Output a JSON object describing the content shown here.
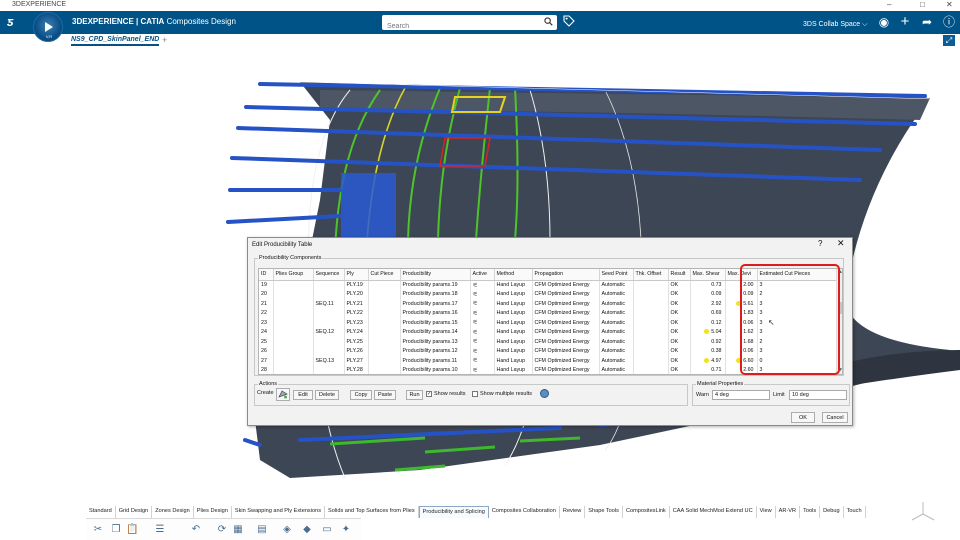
{
  "os_window": {
    "title": "3DEXPERIENCE",
    "controls": [
      "–",
      "□",
      "✕"
    ]
  },
  "header": {
    "brand_bold": "3DEXPERIENCE | CATIA",
    "brand_app": "Composites Design",
    "compass_label": "V,R",
    "search_placeholder": "Search",
    "collab_space": "3DS Collab Space ⌵",
    "colors": {
      "header_bg": "#005386",
      "accent": "#0a4f82"
    }
  },
  "document_tab": {
    "name": "NS9_CPD_SkinPanel_END",
    "add": "+"
  },
  "dialog": {
    "title": "Edit Producibility Table",
    "help": "?",
    "close": "✕",
    "components_group": "Producibility Components",
    "columns": [
      "ID",
      "Plies Group",
      "Sequence",
      "Ply",
      "Cut Piece",
      "Producibility",
      "Active",
      "Method",
      "Propagation",
      "Seed Point",
      "Thk. Offset",
      "Result",
      "Max. Shear",
      "Max. Devi",
      "Estimated Cut Pieces"
    ],
    "rows": [
      {
        "id": "19",
        "group": "",
        "seq": "",
        "ply": "PLY.19",
        "cut": "",
        "prod": "Producibility params.19",
        "method": "Hand Layup",
        "prop": "CFM Optimized Energy",
        "seed": "Automatic",
        "thk": "",
        "result": "OK",
        "shear": "0.73",
        "shear_warn": false,
        "dev": "2.00",
        "dev_warn": false,
        "cuts": "3"
      },
      {
        "id": "20",
        "group": "",
        "seq": "",
        "ply": "PLY.20",
        "cut": "",
        "prod": "Producibility params.18",
        "method": "Hand Layup",
        "prop": "CFM Optimized Energy",
        "seed": "Automatic",
        "thk": "",
        "result": "OK",
        "shear": "0.09",
        "shear_warn": false,
        "dev": "0.09",
        "dev_warn": false,
        "cuts": "2"
      },
      {
        "id": "21",
        "group": "",
        "seq": "SEQ.11",
        "ply": "PLY.21",
        "cut": "",
        "prod": "Producibility params.17",
        "method": "Hand Layup",
        "prop": "CFM Optimized Energy",
        "seed": "Automatic",
        "thk": "",
        "result": "OK",
        "shear": "2.92",
        "shear_warn": false,
        "dev": "5.61",
        "dev_warn": true,
        "cuts": "3"
      },
      {
        "id": "22",
        "group": "",
        "seq": "",
        "ply": "PLY.22",
        "cut": "",
        "prod": "Producibility params.16",
        "method": "Hand Layup",
        "prop": "CFM Optimized Energy",
        "seed": "Automatic",
        "thk": "",
        "result": "OK",
        "shear": "0.69",
        "shear_warn": false,
        "dev": "1.83",
        "dev_warn": false,
        "cuts": "3"
      },
      {
        "id": "23",
        "group": "",
        "seq": "",
        "ply": "PLY.23",
        "cut": "",
        "prod": "Producibility params.15",
        "method": "Hand Layup",
        "prop": "CFM Optimized Energy",
        "seed": "Automatic",
        "thk": "",
        "result": "OK",
        "shear": "0.12",
        "shear_warn": false,
        "dev": "0.06",
        "dev_warn": false,
        "cuts": "3"
      },
      {
        "id": "24",
        "group": "",
        "seq": "SEQ.12",
        "ply": "PLY.24",
        "cut": "",
        "prod": "Producibility params.14",
        "method": "Hand Layup",
        "prop": "CFM Optimized Energy",
        "seed": "Automatic",
        "thk": "",
        "result": "OK",
        "shear": "5.04",
        "shear_warn": true,
        "dev": "1.62",
        "dev_warn": false,
        "cuts": "3"
      },
      {
        "id": "25",
        "group": "",
        "seq": "",
        "ply": "PLY.25",
        "cut": "",
        "prod": "Producibility params.13",
        "method": "Hand Layup",
        "prop": "CFM Optimized Energy",
        "seed": "Automatic",
        "thk": "",
        "result": "OK",
        "shear": "0.92",
        "shear_warn": false,
        "dev": "1.68",
        "dev_warn": false,
        "cuts": "2"
      },
      {
        "id": "26",
        "group": "",
        "seq": "",
        "ply": "PLY.26",
        "cut": "",
        "prod": "Producibility params.12",
        "method": "Hand Layup",
        "prop": "CFM Optimized Energy",
        "seed": "Automatic",
        "thk": "",
        "result": "OK",
        "shear": "0.38",
        "shear_warn": false,
        "dev": "0.06",
        "dev_warn": false,
        "cuts": "3"
      },
      {
        "id": "27",
        "group": "",
        "seq": "SEQ.13",
        "ply": "PLY.27",
        "cut": "",
        "prod": "Producibility params.11",
        "method": "Hand Layup",
        "prop": "CFM Optimized Energy",
        "seed": "Automatic",
        "thk": "",
        "result": "OK",
        "shear": "4.97",
        "shear_warn": true,
        "dev": "6.60",
        "dev_warn": true,
        "cuts": "0"
      },
      {
        "id": "28",
        "group": "",
        "seq": "",
        "ply": "PLY.28",
        "cut": "",
        "prod": "Producibility params.10",
        "method": "Hand Layup",
        "prop": "CFM Optimized Energy",
        "seed": "Automatic",
        "thk": "",
        "result": "OK",
        "shear": "0.71",
        "shear_warn": false,
        "dev": "2.60",
        "dev_warn": false,
        "cuts": "3"
      }
    ],
    "actions": {
      "group": "Actions",
      "create": "Create",
      "edit": "Edit",
      "delete": "Delete",
      "copy": "Copy",
      "paste": "Paste",
      "run": "Run",
      "show_results": "Show results",
      "show_results_checked": true,
      "show_multiple": "Show multiple results",
      "show_multiple_checked": false
    },
    "material": {
      "group": "Material Properties",
      "warn_label": "Warn",
      "warn_value": "4 deg",
      "limit_label": "Limit",
      "limit_value": "10 deg"
    },
    "ok": "OK",
    "cancel": "Cancel"
  },
  "workbench_tabs": [
    "Standard",
    "Grid Design",
    "Zones Design",
    "Plies Design",
    "Skin Swapping and Ply Extensions",
    "Solids and Top Surfaces from Plies",
    "Producibility and Splicing",
    "Composites Collaboration",
    "Review",
    "Shape Tools",
    "CompositesLink",
    "CAA Solid MechMod Extend UC",
    "View",
    "AR-VR",
    "Tools",
    "Debug",
    "Touch"
  ],
  "active_workbench": "Producibility and Splicing",
  "icons": [
    "scissors-icon",
    "copy-icon",
    "paste-icon",
    "properties-icon",
    "undo-icon",
    "refresh-icon",
    "grid-icon",
    "table-icon",
    "producibility-icon",
    "ply-icon",
    "flatten-icon",
    "splice-icon"
  ]
}
